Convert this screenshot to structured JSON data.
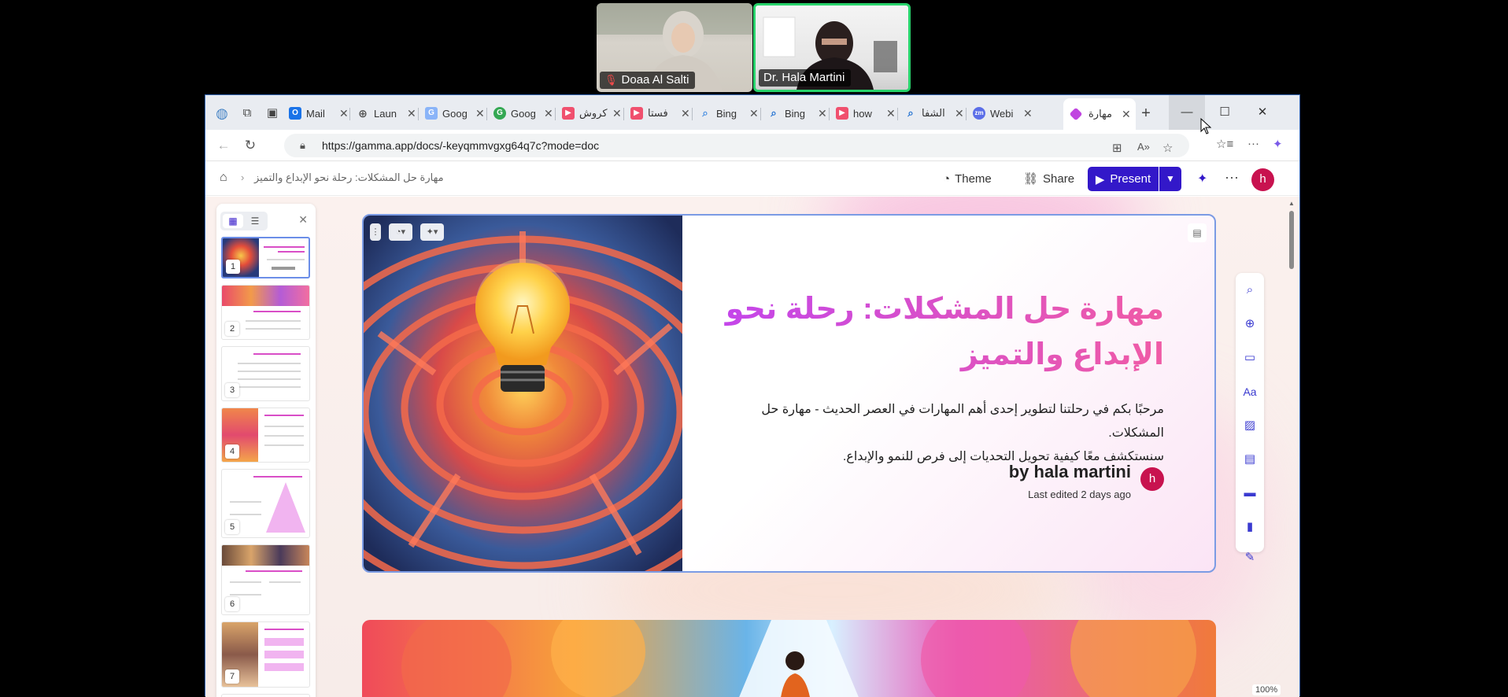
{
  "meeting": {
    "participants": [
      {
        "name": "Doaa Al Salti",
        "muted": true
      },
      {
        "name": "Dr. Hala Martini",
        "muted": false,
        "active_speaker": true
      }
    ]
  },
  "browser": {
    "tabs": [
      {
        "label": "Mail",
        "color": "#1a73e8"
      },
      {
        "label": "Laun",
        "color": "#5f6368"
      },
      {
        "label": "Goog",
        "color": "#4a7bd9"
      },
      {
        "label": "Goog",
        "color": "#34a853"
      },
      {
        "label": "كروش",
        "color": "#f0506e"
      },
      {
        "label": "فستا",
        "color": "#f0506e"
      },
      {
        "label": "Bing",
        "color": "#4a90e2"
      },
      {
        "label": "Bing",
        "color": "#1f6fd1"
      },
      {
        "label": "how",
        "color": "#f0506e"
      },
      {
        "label": "الشفا",
        "color": "#1f6fd1"
      },
      {
        "label": "Webi",
        "color": "#5b6ee8"
      },
      {
        "label": "مهارة",
        "color": "#c046e0",
        "active": true
      }
    ],
    "url": "https://gamma.app/docs/-keyqmmvgxg64q7c?mode=doc"
  },
  "app": {
    "breadcrumb": "مهارة حل المشكلات: رحلة نحو الإبداع والتميز",
    "theme_label": "Theme",
    "share_label": "Share",
    "present_label": "Present",
    "avatar_initial": "h",
    "slides": [
      {
        "number": "1"
      },
      {
        "number": "2"
      },
      {
        "number": "3"
      },
      {
        "number": "4"
      },
      {
        "number": "5"
      },
      {
        "number": "6"
      },
      {
        "number": "7"
      }
    ],
    "card": {
      "title": "مهارة حل المشكلات: رحلة نحو الإبداع والتميز",
      "body_line1": "مرحبًا بكم في رحلتنا لتطوير إحدى أهم المهارات في العصر الحديث - مهارة حل المشكلات.",
      "body_line2": "سنستكشف معًا كيفية تحويل التحديات إلى فرص للنمو والإبداع.",
      "author": "by hala martini",
      "edited": "Last edited 2 days ago",
      "avatar_initial": "h"
    },
    "zoom": "100%"
  }
}
